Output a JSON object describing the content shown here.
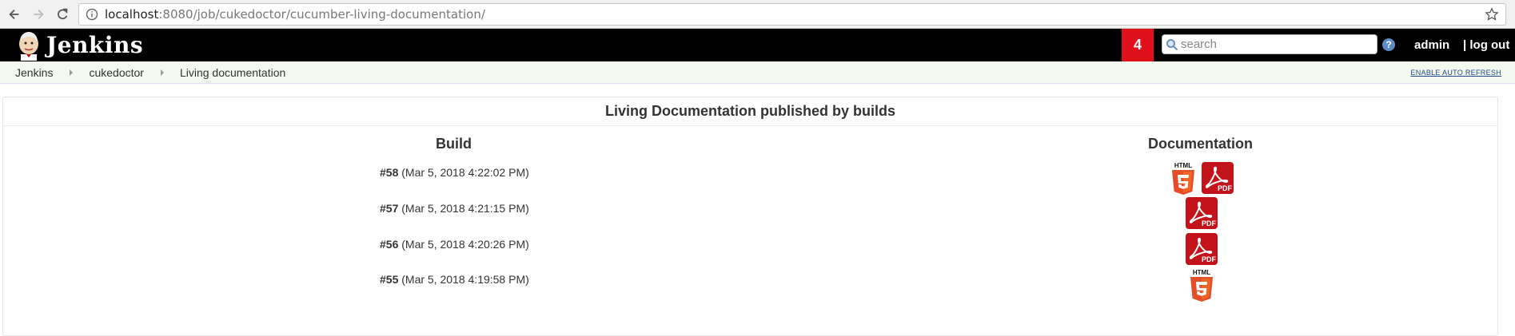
{
  "browser": {
    "url_host": "localhost",
    "url_rest": ":8080/job/cukedoctor/cucumber-living-documentation/"
  },
  "header": {
    "brand": "Jenkins",
    "notification_count": "4",
    "search_placeholder": "search",
    "user": "admin",
    "logout": "| log out"
  },
  "breadcrumbs": [
    "Jenkins",
    "cukedoctor",
    "Living documentation"
  ],
  "auto_refresh": "ENABLE AUTO REFRESH",
  "panel": {
    "title": "Living Documentation published by builds",
    "col_build": "Build",
    "col_docs": "Documentation"
  },
  "builds": [
    {
      "number": "#58",
      "date": "(Mar 5, 2018 4:22:02 PM)",
      "docs": [
        "html",
        "pdf"
      ]
    },
    {
      "number": "#57",
      "date": "(Mar 5, 2018 4:21:15 PM)",
      "docs": [
        "pdf"
      ]
    },
    {
      "number": "#56",
      "date": "(Mar 5, 2018 4:20:26 PM)",
      "docs": [
        "pdf"
      ]
    },
    {
      "number": "#55",
      "date": "(Mar 5, 2018 4:19:58 PM)",
      "docs": [
        "html"
      ]
    }
  ],
  "colors": {
    "header": "#000000",
    "notification": "#e0111a",
    "breadcrumb_bg": "#f3f9ef",
    "pdf_red": "#c4141b",
    "html5_orange": "#e44d26"
  }
}
